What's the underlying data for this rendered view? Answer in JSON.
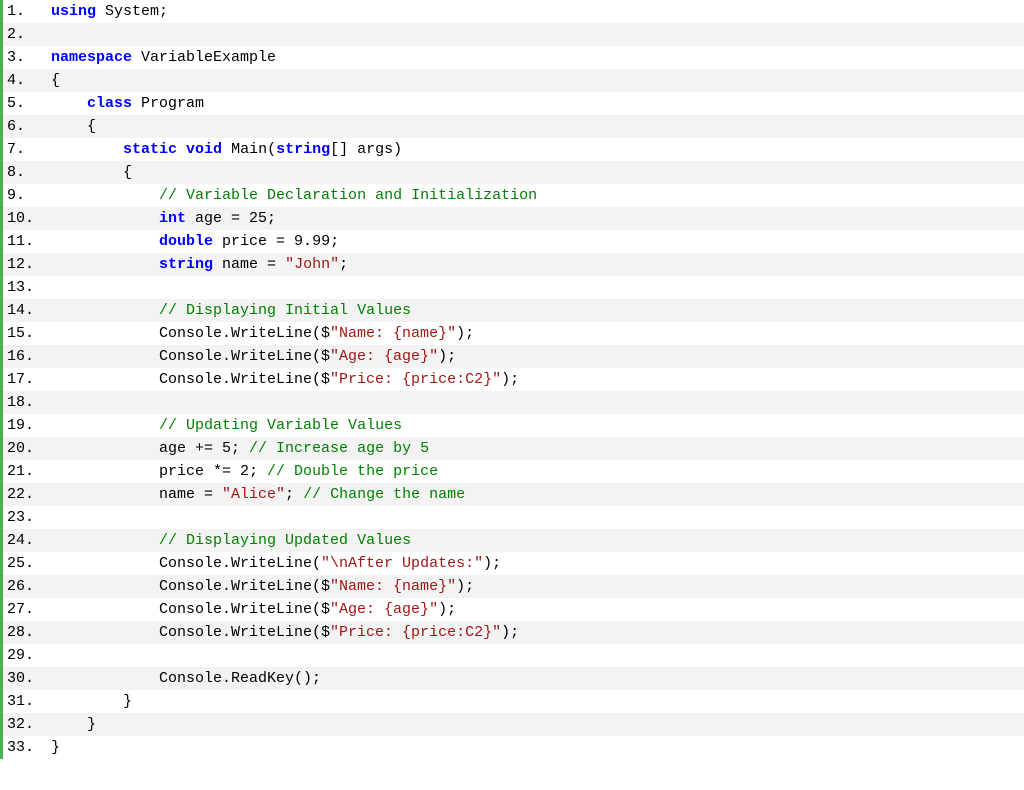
{
  "lines": [
    {
      "num": "1.",
      "html": "<span class='kw'>using</span> System;"
    },
    {
      "num": "2.",
      "html": ""
    },
    {
      "num": "3.",
      "html": "<span class='kw'>namespace</span> VariableExample"
    },
    {
      "num": "4.",
      "html": "{"
    },
    {
      "num": "5.",
      "html": "    <span class='kw'>class</span> Program"
    },
    {
      "num": "6.",
      "html": "    {"
    },
    {
      "num": "7.",
      "html": "        <span class='kw'>static</span> <span class='kw'>void</span> Main(<span class='kw'>string</span>[] args)"
    },
    {
      "num": "8.",
      "html": "        {"
    },
    {
      "num": "9.",
      "html": "            <span class='com'>// Variable Declaration and Initialization</span>"
    },
    {
      "num": "10.",
      "html": "            <span class='kw'>int</span> age = 25;"
    },
    {
      "num": "11.",
      "html": "            <span class='kw'>double</span> price = 9.99;"
    },
    {
      "num": "12.",
      "html": "            <span class='kw'>string</span> name = <span class='str'>\"John\"</span>;"
    },
    {
      "num": "13.",
      "html": ""
    },
    {
      "num": "14.",
      "html": "            <span class='com'>// Displaying Initial Values</span>"
    },
    {
      "num": "15.",
      "html": "            Console.WriteLine($<span class='str'>\"Name: {name}\"</span>);"
    },
    {
      "num": "16.",
      "html": "            Console.WriteLine($<span class='str'>\"Age: {age}\"</span>);"
    },
    {
      "num": "17.",
      "html": "            Console.WriteLine($<span class='str'>\"Price: {price:C2}\"</span>);"
    },
    {
      "num": "18.",
      "html": ""
    },
    {
      "num": "19.",
      "html": "            <span class='com'>// Updating Variable Values</span>"
    },
    {
      "num": "20.",
      "html": "            age += 5; <span class='com'>// Increase age by 5</span>"
    },
    {
      "num": "21.",
      "html": "            price *= 2; <span class='com'>// Double the price</span>"
    },
    {
      "num": "22.",
      "html": "            name = <span class='str'>\"Alice\"</span>; <span class='com'>// Change the name</span>"
    },
    {
      "num": "23.",
      "html": ""
    },
    {
      "num": "24.",
      "html": "            <span class='com'>// Displaying Updated Values</span>"
    },
    {
      "num": "25.",
      "html": "            Console.WriteLine(<span class='str'>\"\\nAfter Updates:\"</span>);"
    },
    {
      "num": "26.",
      "html": "            Console.WriteLine($<span class='str'>\"Name: {name}\"</span>);"
    },
    {
      "num": "27.",
      "html": "            Console.WriteLine($<span class='str'>\"Age: {age}\"</span>);"
    },
    {
      "num": "28.",
      "html": "            Console.WriteLine($<span class='str'>\"Price: {price:C2}\"</span>);"
    },
    {
      "num": "29.",
      "html": ""
    },
    {
      "num": "30.",
      "html": "            Console.ReadKey();"
    },
    {
      "num": "31.",
      "html": "        }"
    },
    {
      "num": "32.",
      "html": "    }"
    },
    {
      "num": "33.",
      "html": "}"
    }
  ]
}
